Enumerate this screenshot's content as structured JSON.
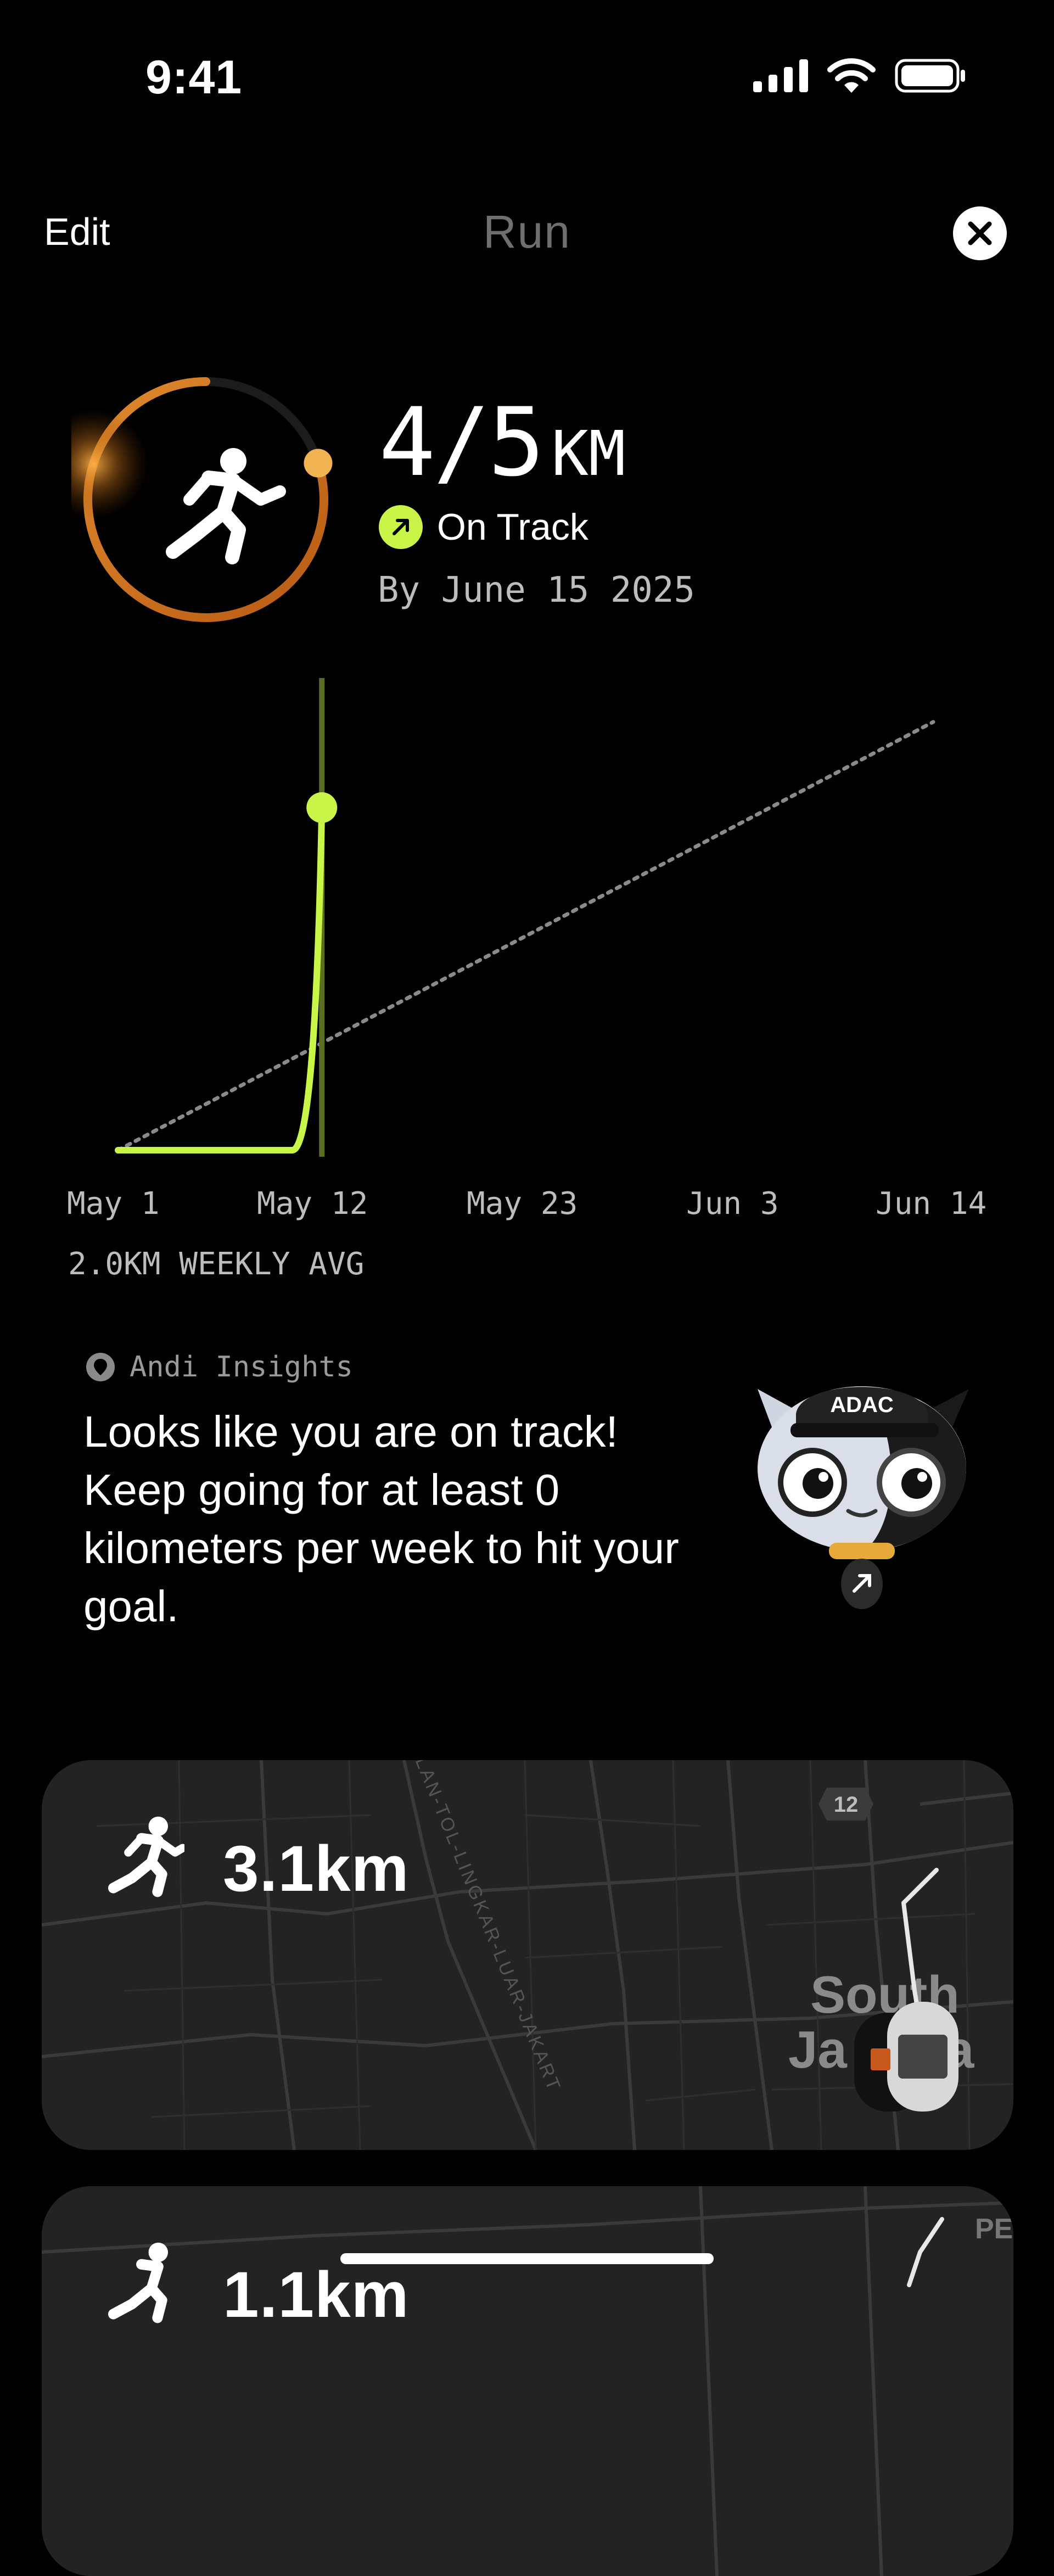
{
  "status_bar": {
    "time": "9:41"
  },
  "header": {
    "edit_label": "Edit",
    "title": "Run"
  },
  "summary": {
    "distance_value": "4/5",
    "distance_unit": "KM",
    "status": "On Track",
    "deadline": "By June 15 2025",
    "progress": 0.8
  },
  "chart_data": {
    "type": "line",
    "x_ticks": [
      "May 1",
      "May 12",
      "May 23",
      "Jun 3",
      "Jun 14"
    ],
    "series": [
      {
        "x": [
          "May 1",
          "May 11",
          "May 12"
        ],
        "values": [
          0,
          0,
          4
        ]
      }
    ],
    "goal_line": {
      "x": [
        "May 1",
        "Jun 14"
      ],
      "values": [
        0,
        5
      ]
    },
    "current_marker": "May 12",
    "ylim": [
      0,
      5
    ],
    "footer": "2.0KM WEEKLY AVG",
    "colors": {
      "series": "#c8f548",
      "goal": "#8a8a8a"
    }
  },
  "insights": {
    "title": "Andi Insights",
    "message": "Looks like you are on track! Keep going for at least 0 kilometers per week to hit your goal.",
    "mascot_cap_text": "ADAC"
  },
  "activities": [
    {
      "distance": "3.1km",
      "map_labels": [
        "South",
        "Ja",
        "a",
        "12",
        "LAN-TOL-LINGKAR-LUAR-JAKART"
      ]
    },
    {
      "distance": "1.1km",
      "map_labels": [
        "PE"
      ]
    }
  ],
  "colors": {
    "accent": "#c8f548",
    "ring_orange": "#d26a1c",
    "card_bg": "#202020"
  }
}
